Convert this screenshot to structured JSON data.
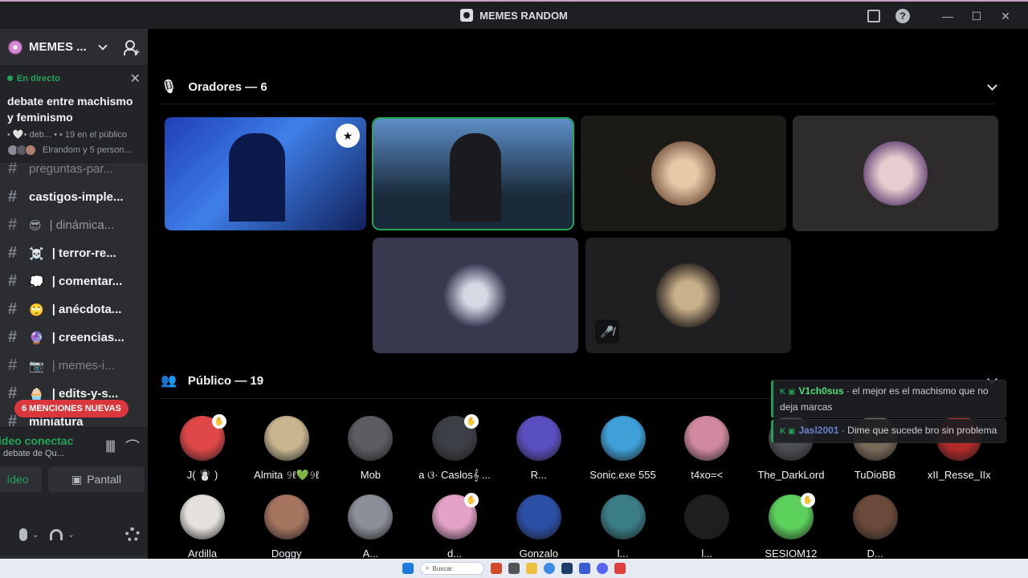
{
  "window": {
    "title": "MEMES RANDOM"
  },
  "server": {
    "name": "MEMES ..."
  },
  "live": {
    "status": "En directo",
    "title": "debate entre machismo y feminismo",
    "meta": "• 🤍• deb... • • 19 en el público",
    "people": "Elrandom y 5 person..."
  },
  "channels": [
    {
      "name": "preguntas-par...",
      "emoji": "",
      "dim": true
    },
    {
      "name": "castigos-imple...",
      "emoji": ""
    },
    {
      "name": "| dinámica...",
      "emoji": "😎",
      "dim_text": true
    },
    {
      "name": "| terror-re...",
      "emoji": "☠️"
    },
    {
      "name": "| comentar...",
      "emoji": "💭"
    },
    {
      "name": "| anécdota...",
      "emoji": "🙄"
    },
    {
      "name": "| creencias...",
      "emoji": "🔮"
    },
    {
      "name": "| memes-i...",
      "emoji": "📷",
      "dim": true
    },
    {
      "name": "| edits-y-s...",
      "emoji": "🧁"
    },
    {
      "name": "miniatura",
      "emoji": "",
      "dim": true
    }
  ],
  "mentions": "6 MENCIONES NUEVAS",
  "voice": {
    "status": "ideo conectac",
    "sub": "debate de Qu...",
    "video_label": "ídeo",
    "screen_label": "Pantall"
  },
  "speakers": {
    "title": "Oradores — 6",
    "tiles": [
      {
        "name": "speaker-1",
        "bg": "#1e5bd6",
        "avatar": "",
        "mod": true
      },
      {
        "name": "speaker-2",
        "bg": "#3a6ea8",
        "avatar": "",
        "speaking": true
      },
      {
        "name": "speaker-3",
        "bg": "#1a1a1a",
        "avatar": "#d7b48e"
      },
      {
        "name": "speaker-4",
        "bg": "#2e2b2d",
        "avatar": "#c59aa4"
      },
      {
        "name": "speaker-5",
        "bg": "#373a4e",
        "avatar": "#7a7d8c"
      },
      {
        "name": "speaker-6",
        "bg": "#1f1f21",
        "avatar": "#7b6450",
        "muted": true
      }
    ]
  },
  "audience": {
    "title": "Público — 19",
    "members": [
      {
        "name": "J( ☃️ )",
        "color": "#e04848",
        "hand": true
      },
      {
        "name": "Almita 𝟿ℓ💚𝟿ℓ",
        "color": "#c9b68f"
      },
      {
        "name": "Mob",
        "color": "#5c5d63"
      },
      {
        "name": "a ଓ· Caslos𝄞 ...",
        "color": "#3c3f45",
        "hand": true
      },
      {
        "name": "R...",
        "color": "#5a4fc0"
      },
      {
        "name": "Sonic.exe 555",
        "color": "#3fa0d8"
      },
      {
        "name": "t4xo=<",
        "color": "#d18aa0"
      },
      {
        "name": "The_DarkLord",
        "color": "#4c4f55"
      },
      {
        "name": "TuDioBB",
        "color": "#7a6a5a"
      },
      {
        "name": "xII_Resse_IIx",
        "color": "#b22a2a"
      },
      {
        "name": "Ardilla",
        "color": "#e5e1dc"
      },
      {
        "name": "Doggy",
        "color": "#a67560"
      },
      {
        "name": "A...",
        "color": "#8b8f99"
      },
      {
        "name": "d...",
        "color": "#e3a2c6",
        "hand": true
      },
      {
        "name": "Gonzalo",
        "color": "#2c4fa6"
      },
      {
        "name": "l...",
        "color": "#3a7d86"
      },
      {
        "name": "l...",
        "color": "#1f1f1f"
      },
      {
        "name": "SESIOM12",
        "color": "#5cd15c",
        "hand": true
      },
      {
        "name": "D...",
        "color": "#6a4a3a"
      }
    ]
  },
  "chat": [
    {
      "nick": "V1ch0sus",
      "nick_color": "#57f287",
      "text": " · el mejor es el machismo que no deja marcas"
    },
    {
      "nick": "Jasl2001",
      "nick_color": "#7289da",
      "text": " · Dime que sucede bro sin problema"
    }
  ],
  "taskbar": {
    "search": "Buscar"
  },
  "colors": {
    "accent": "#23a55a",
    "mention": "#da373c",
    "bg": "#000000",
    "sidebar": "#2b2d31"
  }
}
